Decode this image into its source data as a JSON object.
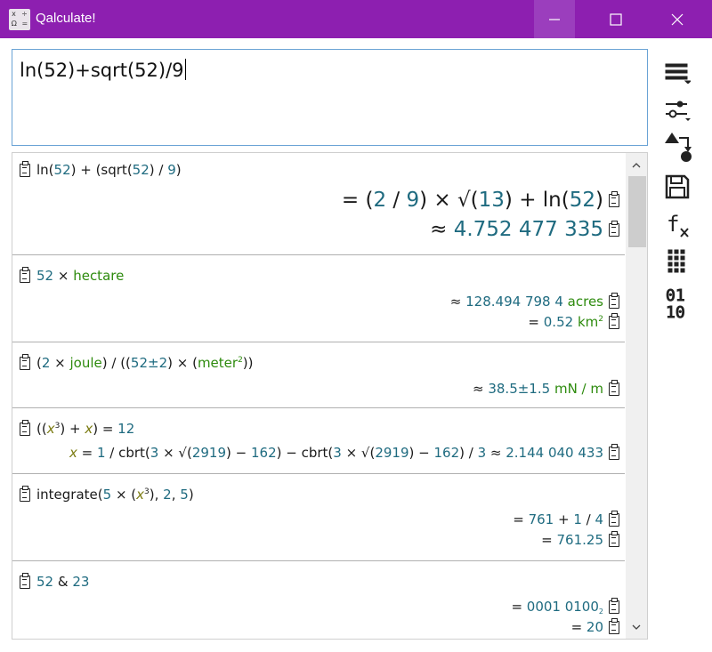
{
  "window": {
    "title": "Qalculate!"
  },
  "expression": {
    "value": "ln(52)+sqrt(52)/9"
  },
  "toolbar": {
    "icons": [
      "menu-icon",
      "settings-icon",
      "convert-icon",
      "save-icon",
      "functions-icon",
      "keypad-icon",
      "binary-icon"
    ],
    "binary_top": "01",
    "binary_bottom": "10",
    "fx": "f"
  },
  "history": [
    {
      "question": "ln(52) + (sqrt(52) ∕ 9)",
      "answers": [
        "= (2 ∕ 9) × √(13) + ln(52)",
        "≈ 4.752 477 335"
      ]
    },
    {
      "question": "52 × hectare",
      "answers": [
        "≈ 128.494 798 4 acres",
        "= 0.52 km2"
      ]
    },
    {
      "question": "(2 × joule) ∕ ((52±2) × (meter2))",
      "answers": [
        "≈ 38.5±1.5 mN ∕ m"
      ]
    },
    {
      "question": "((x3) + x) = 12",
      "answers": [
        "x = 1 ∕ cbrt(3 × √(2919) − 162) − cbrt(3 × √(2919) − 162) ∕ 3 ≈ 2.144 040 433"
      ]
    },
    {
      "question": "integrate(5 × (x3), 2, 5)",
      "answers": [
        "= 761 + 1 ∕ 4",
        "= 761.25"
      ]
    },
    {
      "question": "52 & 23",
      "answers": [
        "= 0001 0100₂",
        "= 20"
      ]
    }
  ]
}
